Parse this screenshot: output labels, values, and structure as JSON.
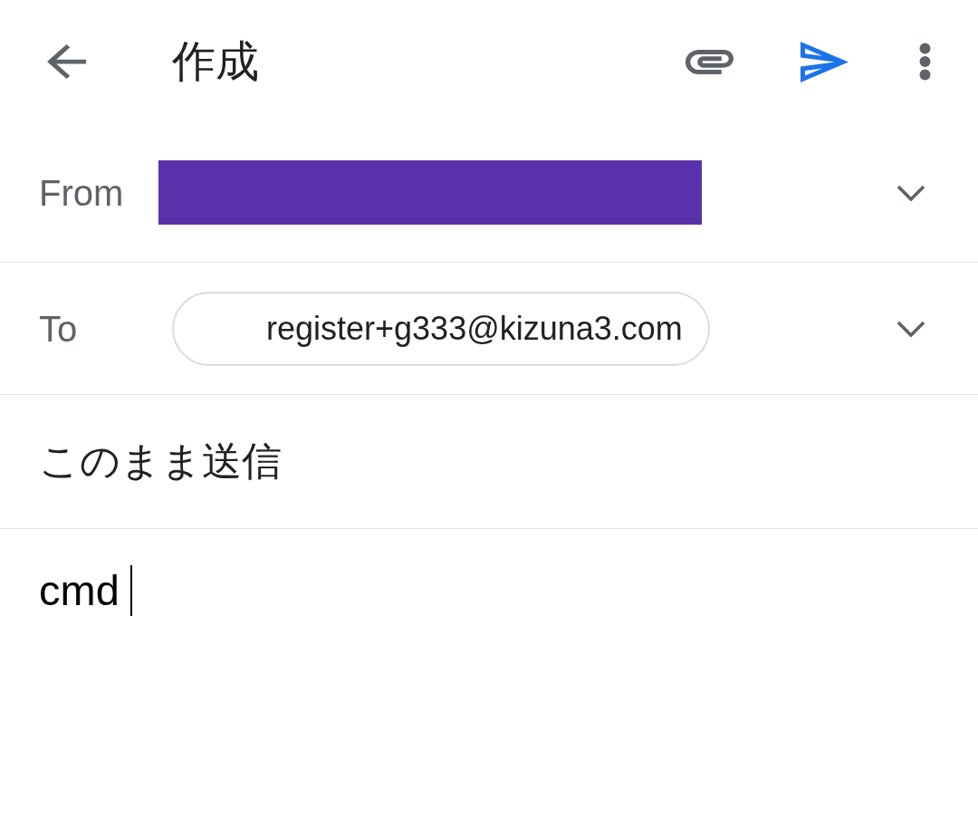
{
  "app_bar": {
    "title": "作成"
  },
  "from": {
    "label": "From",
    "redacted": true
  },
  "to": {
    "label": "To",
    "recipients": [
      {
        "address": "register+g333@kizuna3.com"
      }
    ]
  },
  "subject": {
    "value": "このまま送信"
  },
  "body": {
    "value": "cmd",
    "focused": true
  }
}
